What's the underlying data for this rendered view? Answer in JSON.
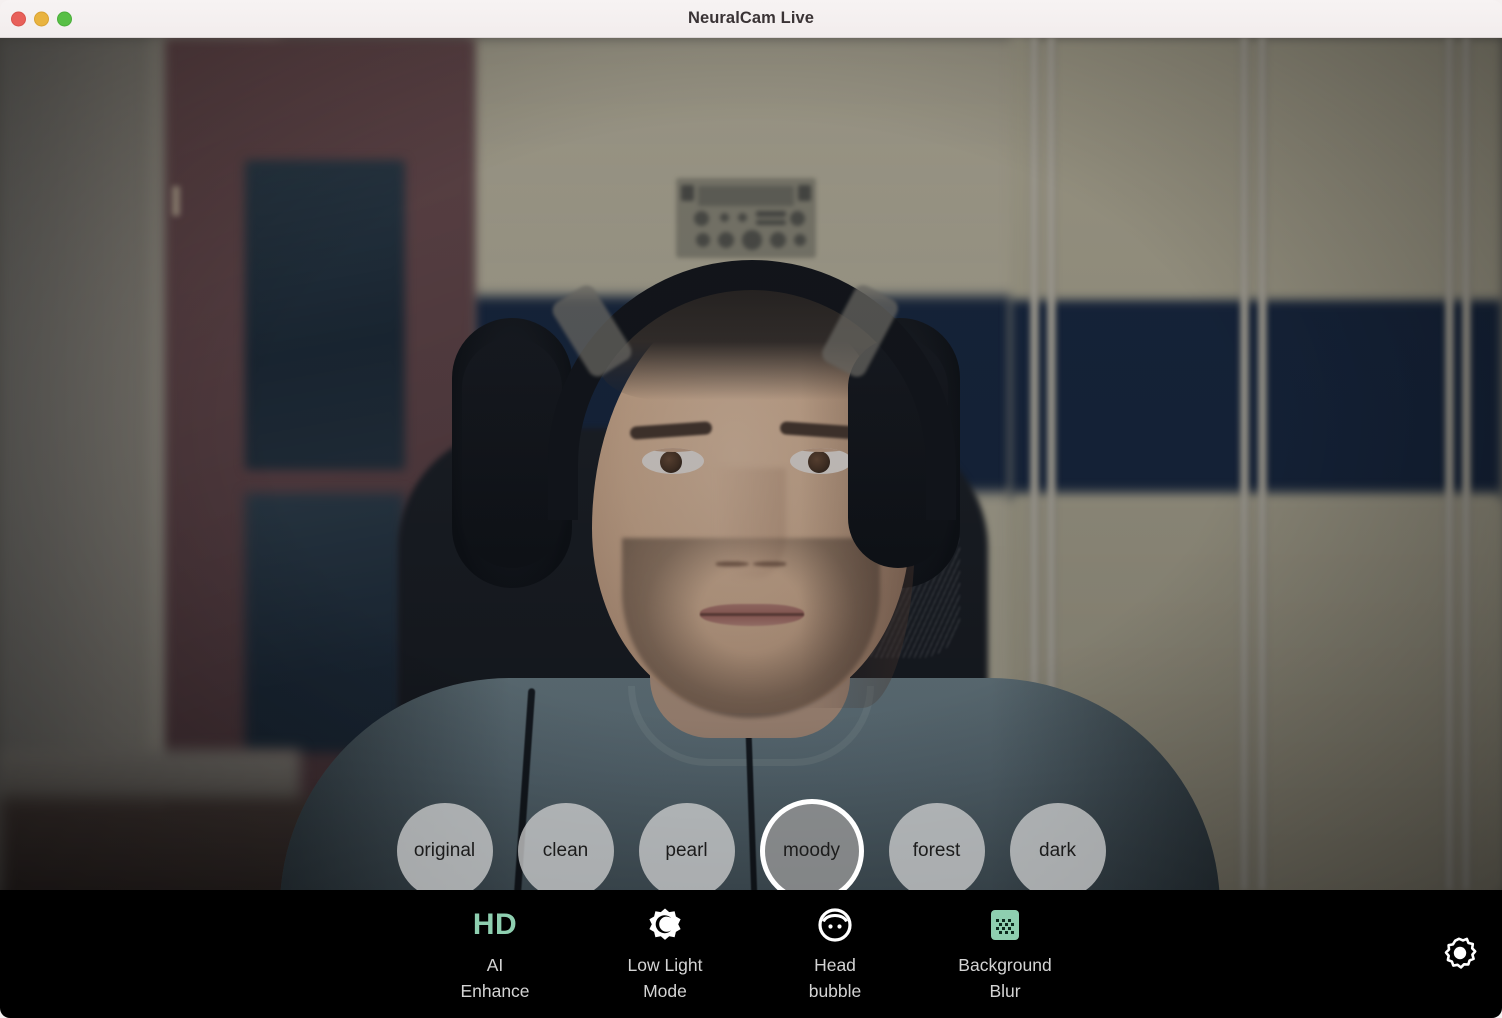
{
  "window": {
    "title": "NeuralCam Live",
    "controls": [
      {
        "name": "close",
        "color": "#e8605a"
      },
      {
        "name": "minimize",
        "color": "#e9b33f"
      },
      {
        "name": "maximize",
        "color": "#58bf45"
      }
    ]
  },
  "video": {
    "description": "Live webcam preview of a man wearing black over-ear headphones and a gray t-shirt, seated in an office chair in front of a wall with a door on the left and a wardrobe on the right"
  },
  "filters": {
    "selected": "moody",
    "items": [
      {
        "id": "original",
        "label": "original",
        "selected": false
      },
      {
        "id": "clean",
        "label": "clean",
        "selected": false
      },
      {
        "id": "pearl",
        "label": "pearl",
        "selected": false
      },
      {
        "id": "moody",
        "label": "moody",
        "selected": true
      },
      {
        "id": "forest",
        "label": "forest",
        "selected": false
      },
      {
        "id": "dark",
        "label": "dark",
        "selected": false
      }
    ]
  },
  "toolbar": {
    "items": [
      {
        "id": "ai-enhance",
        "icon": "hd-icon",
        "icon_text": "HD",
        "line1": "AI",
        "line2": "Enhance",
        "active": true,
        "color": "#8ecfb0"
      },
      {
        "id": "low-light-mode",
        "icon": "low-light-icon",
        "line1": "Low Light",
        "line2": "Mode",
        "active": false,
        "color": "#ffffff"
      },
      {
        "id": "head-bubble",
        "icon": "head-bubble-icon",
        "line1": "Head",
        "line2": "bubble",
        "active": false,
        "color": "#ffffff"
      },
      {
        "id": "background-blur",
        "icon": "background-blur-icon",
        "line1": "Background",
        "line2": "Blur",
        "active": true,
        "color": "#8ecfb0"
      }
    ],
    "settings": {
      "icon": "gear-icon",
      "label": "Settings"
    }
  },
  "colors": {
    "accent_green": "#8ecfb0",
    "bar_background": "#000000",
    "titlebar_background": "#f4efef",
    "title_text": "#3a3335",
    "bubble_fill": "rgba(215,215,215,0.72)",
    "bubble_selected_ring": "#ffffff"
  }
}
